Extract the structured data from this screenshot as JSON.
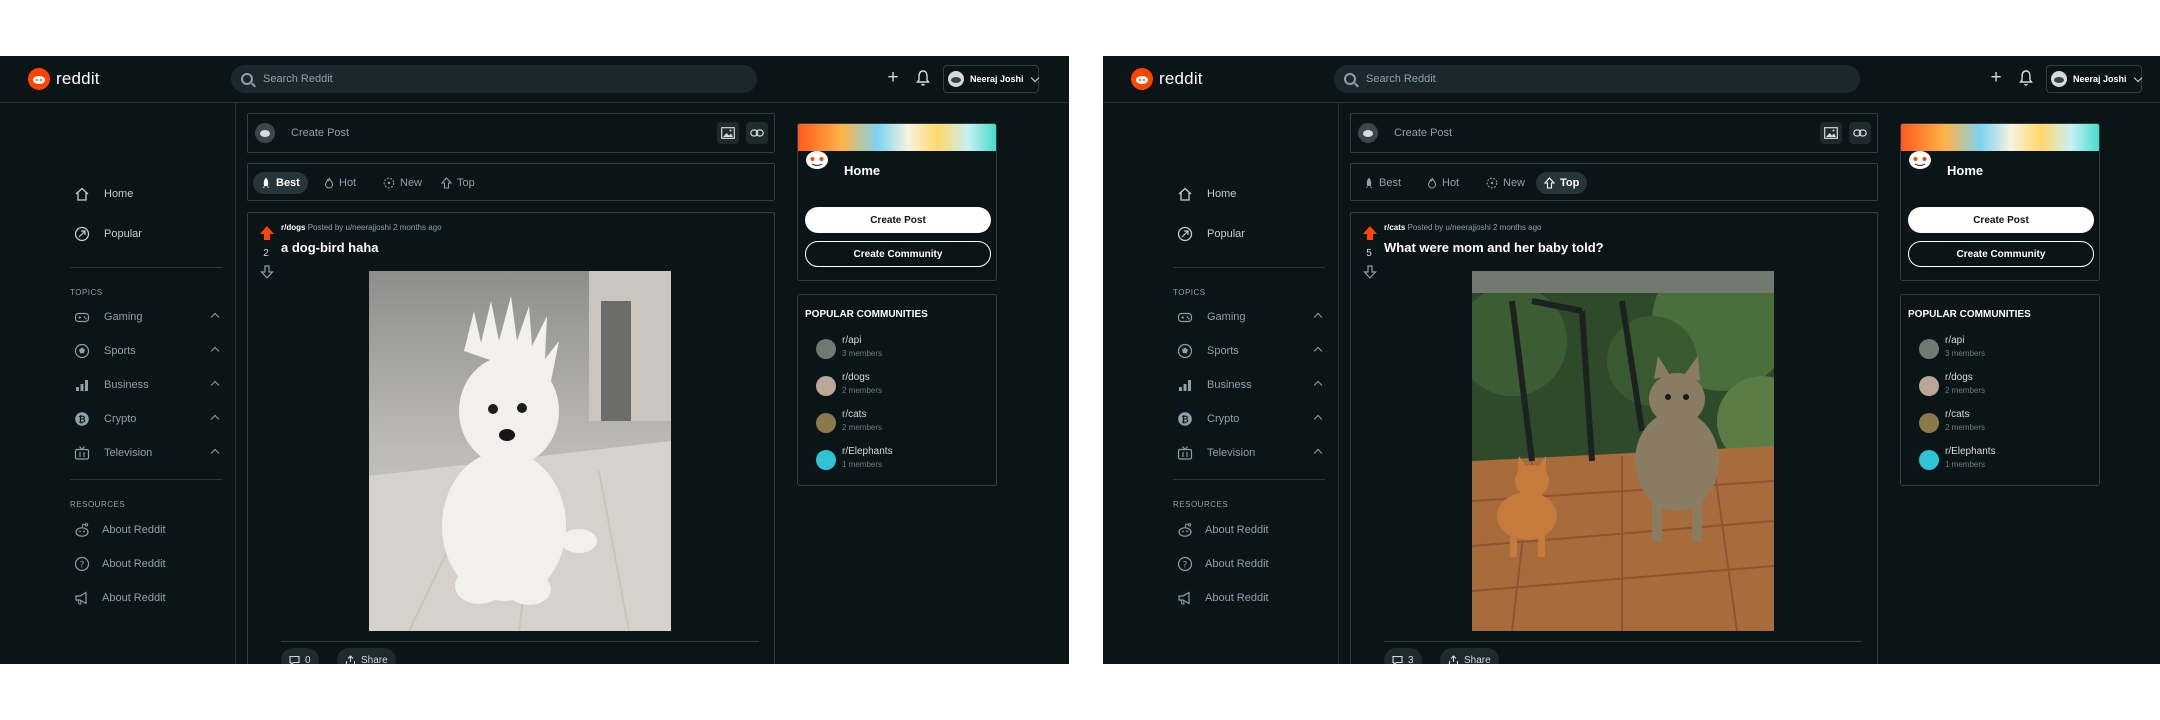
{
  "screens": [
    {
      "header": {
        "logo_text": "reddit",
        "search_placeholder": "Search Reddit",
        "plus_label": "+",
        "user_name": "Neeraj Joshi"
      },
      "sidebar": {
        "home_label": "Home",
        "popular_label": "Popular",
        "topics_title": "TOPICS",
        "topics": [
          "Gaming",
          "Sports",
          "Business",
          "Crypto",
          "Television"
        ],
        "resources_title": "RESOURCES",
        "resources": [
          "About Reddit",
          "About Reddit",
          "About Reddit"
        ]
      },
      "create_post": {
        "placeholder": "Create Post"
      },
      "sort": {
        "options": [
          "Best",
          "Hot",
          "New",
          "Top"
        ],
        "active": "Best"
      },
      "post": {
        "subreddit": "r/dogs",
        "posted_by": "Posted by u/neerajjoshi",
        "time": "2 months ago",
        "votes": "2",
        "title": "a dog-bird haha",
        "comments": "0",
        "share_label": "Share",
        "image_subject": "white fluffy dog with spiky hair sitting on a tiled floor"
      },
      "home_card": {
        "title": "Home",
        "create_post_label": "Create Post",
        "create_community_label": "Create Community"
      },
      "popular": {
        "title": "POPULAR COMMUNITIES",
        "items": [
          {
            "name": "r/api",
            "members": "3 members",
            "avatar_color": "#6f7a72"
          },
          {
            "name": "r/dogs",
            "members": "2 members",
            "avatar_color": "#b9a89a"
          },
          {
            "name": "r/cats",
            "members": "2 members",
            "avatar_color": "#8a7a4a"
          },
          {
            "name": "r/Elephants",
            "members": "1 members",
            "avatar_color": "#2ec4d6"
          }
        ]
      }
    },
    {
      "header": {
        "logo_text": "reddit",
        "search_placeholder": "Search Reddit",
        "plus_label": "+",
        "user_name": "Neeraj Joshi"
      },
      "sidebar": {
        "home_label": "Home",
        "popular_label": "Popular",
        "topics_title": "TOPICS",
        "topics": [
          "Gaming",
          "Sports",
          "Business",
          "Crypto",
          "Television"
        ],
        "resources_title": "RESOURCES",
        "resources": [
          "About Reddit",
          "About Reddit",
          "About Reddit"
        ]
      },
      "create_post": {
        "placeholder": "Create Post"
      },
      "sort": {
        "options": [
          "Best",
          "Hot",
          "New",
          "Top"
        ],
        "active": "Top"
      },
      "post": {
        "subreddit": "r/cats",
        "posted_by": "Posted by u/neerajjoshi",
        "time": "2 months ago",
        "votes": "5",
        "title": "What were mom and her baby told?",
        "comments": "3",
        "share_label": "Share",
        "image_subject": "a tabby cat and an orange kitten walking on a brick patio in a garden"
      },
      "home_card": {
        "title": "Home",
        "create_post_label": "Create Post",
        "create_community_label": "Create Community"
      },
      "popular": {
        "title": "POPULAR COMMUNITIES",
        "items": [
          {
            "name": "r/api",
            "members": "3 members",
            "avatar_color": "#6f7a72"
          },
          {
            "name": "r/dogs",
            "members": "2 members",
            "avatar_color": "#b9a89a"
          },
          {
            "name": "r/cats",
            "members": "2 members",
            "avatar_color": "#8a7a4a"
          },
          {
            "name": "r/Elephants",
            "members": "1 members",
            "avatar_color": "#2ec4d6"
          }
        ]
      }
    }
  ],
  "colors": {
    "background": "#0b1416",
    "accent": "#ff4500",
    "muted_text": "#8ba2ad",
    "border": "#343d41"
  }
}
